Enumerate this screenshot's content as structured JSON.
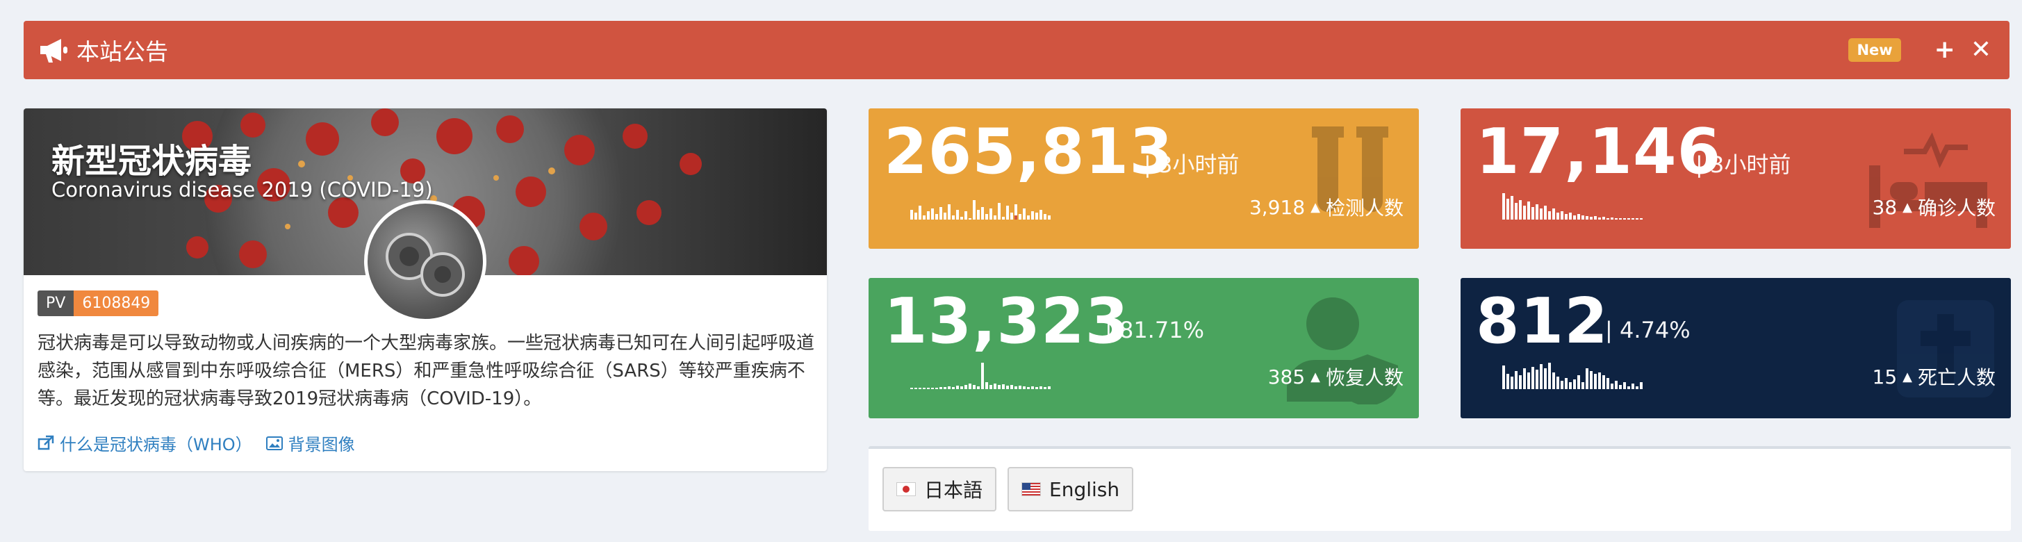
{
  "announcement": {
    "title": "本站公告",
    "badge": "New",
    "expand_icon": "plus-icon",
    "close_icon": "close-icon"
  },
  "profile": {
    "title": "新型冠状病毒",
    "subtitle": "Coronavirus disease 2019 (COVID-19)",
    "pv_label": "PV",
    "pv_value": "6108849",
    "description": "冠状病毒是可以导致动物或人间疾病的一个大型病毒家族。一些冠状病毒已知可在人间引起呼吸道感染，范围从感冒到中东呼吸综合征（MERS）和严重急性呼吸综合征（SARS）等较严重疾病不等。最近发现的冠状病毒导致2019冠状病毒病（COVID-19）。",
    "link_who": "什么是冠状病毒（WHO）",
    "link_bg": "背景图像"
  },
  "stats": {
    "tested": {
      "value": "265,813",
      "meta": "| 3小时前",
      "delta": "3,918",
      "label": "检测人数",
      "color": "#e9a23a",
      "icon": "test-tubes-icon"
    },
    "confirmed": {
      "value": "17,146",
      "meta": "| 3小时前",
      "delta": "38",
      "label": "确诊人数",
      "color": "#d05440",
      "icon": "hospital-bed-icon"
    },
    "recovered": {
      "value": "13,323",
      "meta": "| 81.71%",
      "delta": "385",
      "label": "恢复人数",
      "color": "#4aa45e",
      "icon": "user-shield-icon"
    },
    "deaths": {
      "value": "812",
      "meta": "| 4.74%",
      "delta": "15",
      "label": "死亡人数",
      "color": "#0e2342",
      "icon": "cross-icon"
    }
  },
  "languages": [
    {
      "label": "日本語",
      "flag": "jp-flag-icon"
    },
    {
      "label": "English",
      "flag": "us-flag-icon"
    }
  ]
}
